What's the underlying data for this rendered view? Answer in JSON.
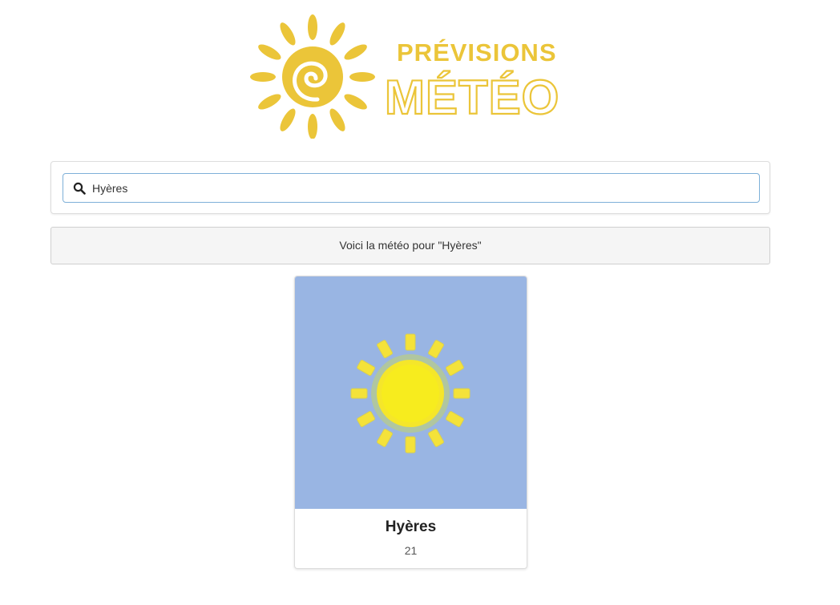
{
  "logo": {
    "line1": "PRÉVISIONS",
    "line2": "MÉTÉO",
    "color": "#ebc539"
  },
  "search": {
    "icon": "search-icon",
    "value": "Hyères",
    "placeholder": ""
  },
  "result": {
    "message": "Voici la météo pour \"Hyères\""
  },
  "card": {
    "city": "Hyères",
    "temperature": "21",
    "weather_icon": "sun-icon",
    "image_background": "#99b5e3"
  }
}
